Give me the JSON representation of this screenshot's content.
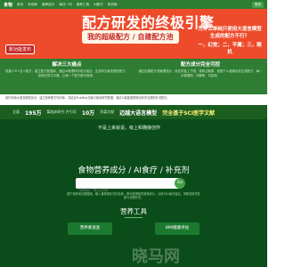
{
  "nav": {
    "logo": "食物",
    "items": [
      "首页",
      "补剂库",
      "营养成分",
      "每日一问",
      "营养工具",
      "AI配方",
      "知识库"
    ],
    "login_label": "登录"
  },
  "hero": {
    "badge": "新功能发布",
    "title": "配方研发的终极引擎",
    "subtitle": "我的超级配方 / 自建配方池",
    "question_line1": "为什么单纯只使用大语言模型生成的配方不行？",
    "question_line2": "一，幻觉；二，平庸；三，随机"
  },
  "features": {
    "left_title": "解决三大痛点",
    "left_body": "收集170+名人配方，建立配方数据库，通过AI推理科学成分组合，生成有文献依据的配方，拒绝幻觉与平庸，让每一个配方都可追溯。",
    "right_title": "配方成分完全可控",
    "right_body": "通过自建配方池管理成分，设定剂量上下限，排除过敏原，依据个人健康目标生成配方，每一步都透明、可解释、可复现。"
  },
  "intro": "我们利用大语言模型技术，建立营养配方知识库，并结合PubMed文献与临床研究数据，通过AI智能推理得出科学合理的补剂配方。",
  "stats": {
    "prefix": "全量",
    "papers": "195万",
    "mid": "篇临床研究   并引用",
    "refs": "10万",
    "suffix": "多篇文献",
    "model_title": "迈越大语言模型",
    "model_sub": "完全基于SCI医学文献"
  },
  "main": {
    "notice": "不是上来就说，级上和确接创作",
    "nutri_title": "食物营养成分 / AI食疗 / 补充剂",
    "search_placeholder": "请搜索：食品名称",
    "go_label": "Go",
    "desc": "基于营养成分数据库，输入食物或补充剂名称，即可获得相关营养成分、功效与AI食疗建议，帮助您科学饮食与合理补充。",
    "tools_title": "营养工具",
    "tools": [
      "营养素速查",
      "BMI健康评估"
    ],
    "watermark": "晓马网"
  }
}
